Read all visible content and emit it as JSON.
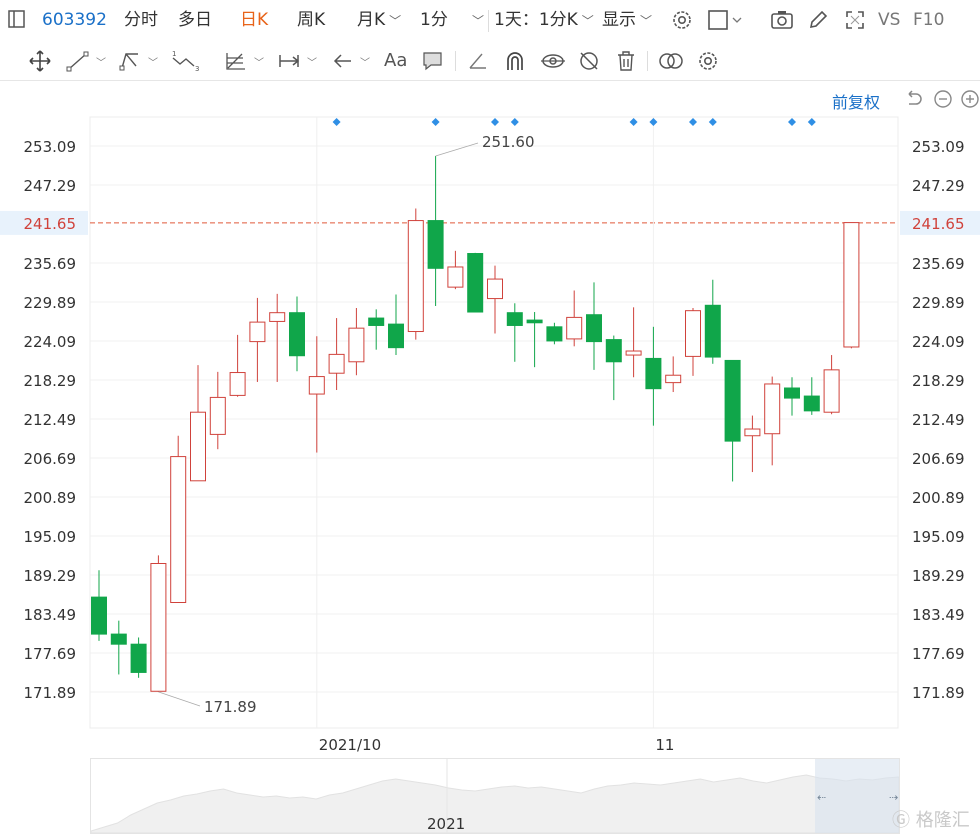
{
  "topbar": {
    "stock_code": "603392",
    "items": [
      "分时",
      "多日",
      "日K",
      "周K",
      "月K",
      "1分"
    ],
    "active": "日K",
    "period_select": "1天：1分K",
    "display_label": "显示",
    "vs_label": "VS",
    "f10_label": "F10"
  },
  "restore_label": "前复权",
  "axis": {
    "y_ticks": [
      "253.09",
      "247.29",
      "241.65",
      "235.69",
      "229.89",
      "224.09",
      "218.29",
      "212.49",
      "206.69",
      "200.89",
      "195.09",
      "189.29",
      "183.49",
      "177.69",
      "171.89"
    ],
    "current_price": "241.65",
    "x_labels": [
      "2021/10",
      "11"
    ],
    "high_label": "251.60",
    "low_label": "171.89",
    "navigator_label": "2021"
  },
  "colors": {
    "up": "#d0423b",
    "down": "#10a64a",
    "price_line": "#e0593a",
    "accent": "#1a70c8",
    "marker": "#2f8fe5"
  },
  "chart_data": {
    "type": "candlestick",
    "ylim": [
      169,
      256
    ],
    "candles": [
      {
        "o": 186.0,
        "c": 180.5,
        "h": 190.0,
        "l": 179.5
      },
      {
        "o": 180.5,
        "c": 179.0,
        "h": 182.5,
        "l": 174.5
      },
      {
        "o": 179.0,
        "c": 174.8,
        "h": 180.0,
        "l": 174.0
      },
      {
        "o": 172.0,
        "c": 191.0,
        "h": 192.2,
        "l": 171.9
      },
      {
        "o": 185.2,
        "c": 206.9,
        "h": 210.0,
        "l": 185.2
      },
      {
        "o": 203.3,
        "c": 213.5,
        "h": 220.5,
        "l": 203.3
      },
      {
        "o": 210.2,
        "c": 215.7,
        "h": 219.5,
        "l": 208.0
      },
      {
        "o": 216.0,
        "c": 219.4,
        "h": 225.0,
        "l": 215.8
      },
      {
        "o": 224.0,
        "c": 226.9,
        "h": 230.5,
        "l": 218.0
      },
      {
        "o": 227.0,
        "c": 228.3,
        "h": 231.1,
        "l": 218.0
      },
      {
        "o": 228.3,
        "c": 221.9,
        "h": 230.7,
        "l": 219.6
      },
      {
        "o": 216.2,
        "c": 218.8,
        "h": 224.8,
        "l": 207.5
      },
      {
        "o": 219.3,
        "c": 222.1,
        "h": 227.5,
        "l": 216.8
      },
      {
        "o": 221.0,
        "c": 226.0,
        "h": 229.0,
        "l": 219.0
      },
      {
        "o": 227.5,
        "c": 226.4,
        "h": 228.8,
        "l": 222.8
      },
      {
        "o": 226.6,
        "c": 223.1,
        "h": 231.0,
        "l": 222.0
      },
      {
        "o": 225.5,
        "c": 242.0,
        "h": 243.8,
        "l": 224.3
      },
      {
        "o": 242.0,
        "c": 234.9,
        "h": 251.6,
        "l": 229.3
      },
      {
        "o": 232.1,
        "c": 235.1,
        "h": 237.5,
        "l": 231.8
      },
      {
        "o": 237.1,
        "c": 228.4,
        "h": 237.2,
        "l": 229.9
      },
      {
        "o": 230.4,
        "c": 233.3,
        "h": 235.3,
        "l": 225.2
      },
      {
        "o": 228.3,
        "c": 226.4,
        "h": 229.7,
        "l": 221.0
      },
      {
        "o": 227.2,
        "c": 226.8,
        "h": 228.4,
        "l": 220.2
      },
      {
        "o": 226.2,
        "c": 224.1,
        "h": 226.8,
        "l": 223.6
      },
      {
        "o": 224.4,
        "c": 227.6,
        "h": 231.6,
        "l": 223.3
      },
      {
        "o": 228.0,
        "c": 224.0,
        "h": 232.8,
        "l": 219.8
      },
      {
        "o": 224.3,
        "c": 221.0,
        "h": 224.9,
        "l": 215.3
      },
      {
        "o": 222.0,
        "c": 222.6,
        "h": 229.1,
        "l": 218.7
      },
      {
        "o": 221.5,
        "c": 217.0,
        "h": 226.2,
        "l": 211.5
      },
      {
        "o": 217.9,
        "c": 219.0,
        "h": 221.8,
        "l": 216.5
      },
      {
        "o": 221.8,
        "c": 228.6,
        "h": 229.0,
        "l": 218.9
      },
      {
        "o": 229.4,
        "c": 221.7,
        "h": 233.2,
        "l": 220.7
      },
      {
        "o": 221.2,
        "c": 209.2,
        "h": 221.2,
        "l": 203.2
      },
      {
        "o": 210.0,
        "c": 211.0,
        "h": 213.0,
        "l": 204.6
      },
      {
        "o": 210.3,
        "c": 217.7,
        "h": 218.8,
        "l": 205.6
      },
      {
        "o": 217.1,
        "c": 215.6,
        "h": 218.7,
        "l": 213.0
      },
      {
        "o": 215.9,
        "c": 213.7,
        "h": 218.7,
        "l": 213.1
      },
      {
        "o": 213.5,
        "c": 219.8,
        "h": 222.0,
        "l": 213.2
      },
      {
        "o": 223.2,
        "c": 241.7,
        "h": 241.7,
        "l": 223.0
      }
    ],
    "markers": [
      12,
      17,
      20,
      21,
      27,
      28,
      30,
      31,
      35,
      36
    ],
    "current_price": 241.65,
    "x_labels": [
      {
        "label": "2021/10",
        "index": 11
      },
      {
        "label": "11",
        "index": 28
      }
    ],
    "navigator": {
      "label": "2021",
      "values": [
        2,
        6,
        10,
        18,
        24,
        30,
        33,
        37,
        39,
        42,
        44,
        40,
        38,
        36,
        37,
        35,
        36,
        34,
        38,
        40,
        44,
        48,
        52,
        54,
        52,
        50,
        48,
        45,
        43,
        42,
        44,
        46,
        47,
        45,
        46,
        44,
        42,
        40,
        44,
        47,
        48,
        50,
        49,
        48,
        50,
        52,
        54,
        51,
        53,
        55,
        52,
        50,
        53,
        56,
        58,
        55,
        54,
        52,
        54,
        53,
        55,
        56
      ]
    }
  }
}
